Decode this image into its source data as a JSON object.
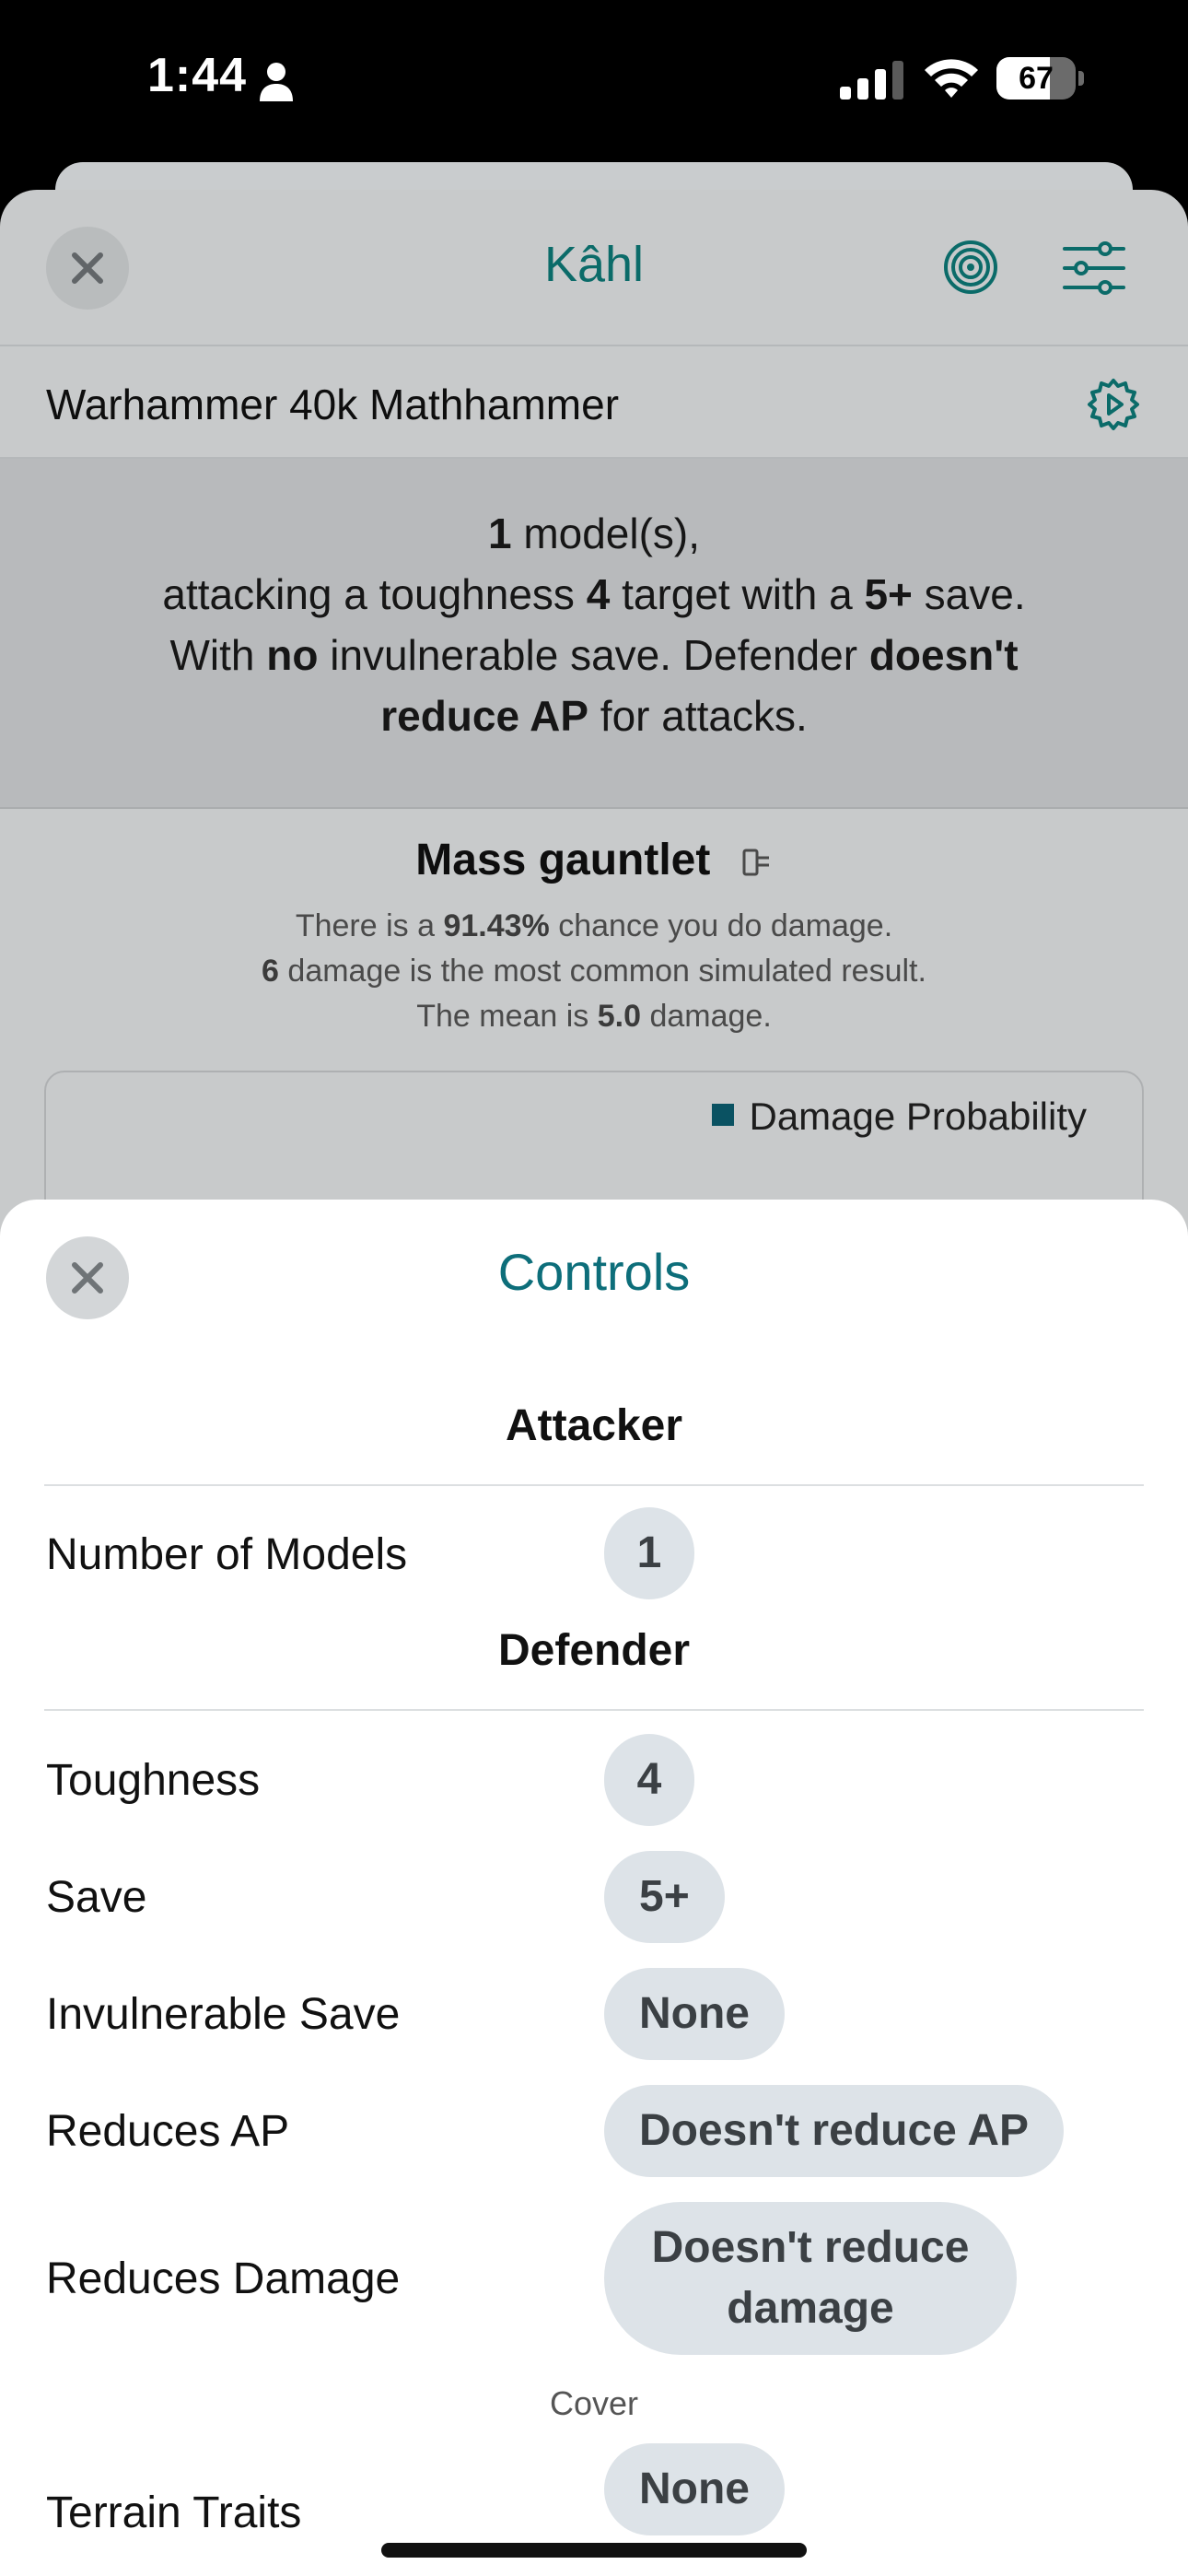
{
  "status_bar": {
    "time": "1:44",
    "battery_level": "67",
    "battery_fraction": 0.67,
    "icons": [
      "person-icon",
      "cellular-signal-icon",
      "wifi-icon",
      "battery-icon"
    ]
  },
  "main": {
    "title": "Kâhl",
    "subheader": "Warhammer 40k Mathhammer",
    "summary": {
      "models_count": "1",
      "line1_suffix": " model(s),",
      "line2_prefix": "attacking a toughness ",
      "toughness": "4",
      "line2_mid": " target with a ",
      "save": "5+",
      "line2_suffix": " save.",
      "line3_prefix": "With ",
      "invuln": "no",
      "line3_suffix": " invulnerable save. Defender ",
      "ap_bold1": "doesn't",
      "ap_bold2": "reduce AP",
      "line4_suffix": " for attacks."
    },
    "weapon": {
      "name": "Mass gauntlet",
      "stat1_prefix": "There is a ",
      "damage_chance": "91.43%",
      "stat1_suffix": " chance you do damage.",
      "common_damage": "6",
      "stat2_suffix": " damage is the most common simulated result.",
      "stat3_prefix": "The mean is ",
      "mean_damage": "5.0",
      "stat3_suffix": " damage."
    },
    "chart_legend": "Damage Probability",
    "colors": {
      "accent": "#0d7a78",
      "legend": "#0c5e70"
    }
  },
  "controls": {
    "title": "Controls",
    "attacker_heading": "Attacker",
    "attacker_rows": [
      {
        "label": "Number of Models",
        "value": "1"
      }
    ],
    "defender_heading": "Defender",
    "defender_rows": [
      {
        "label": "Toughness",
        "value": "4"
      },
      {
        "label": "Save",
        "value": "5+"
      },
      {
        "label": "Invulnerable Save",
        "value": "None"
      },
      {
        "label": "Reduces AP",
        "value": "Doesn't reduce AP"
      },
      {
        "label": "Reduces Damage",
        "value": "Doesn't reduce damage"
      }
    ],
    "cover_label": "Cover",
    "terrain_row": {
      "label": "Terrain Traits",
      "value": "None"
    }
  }
}
